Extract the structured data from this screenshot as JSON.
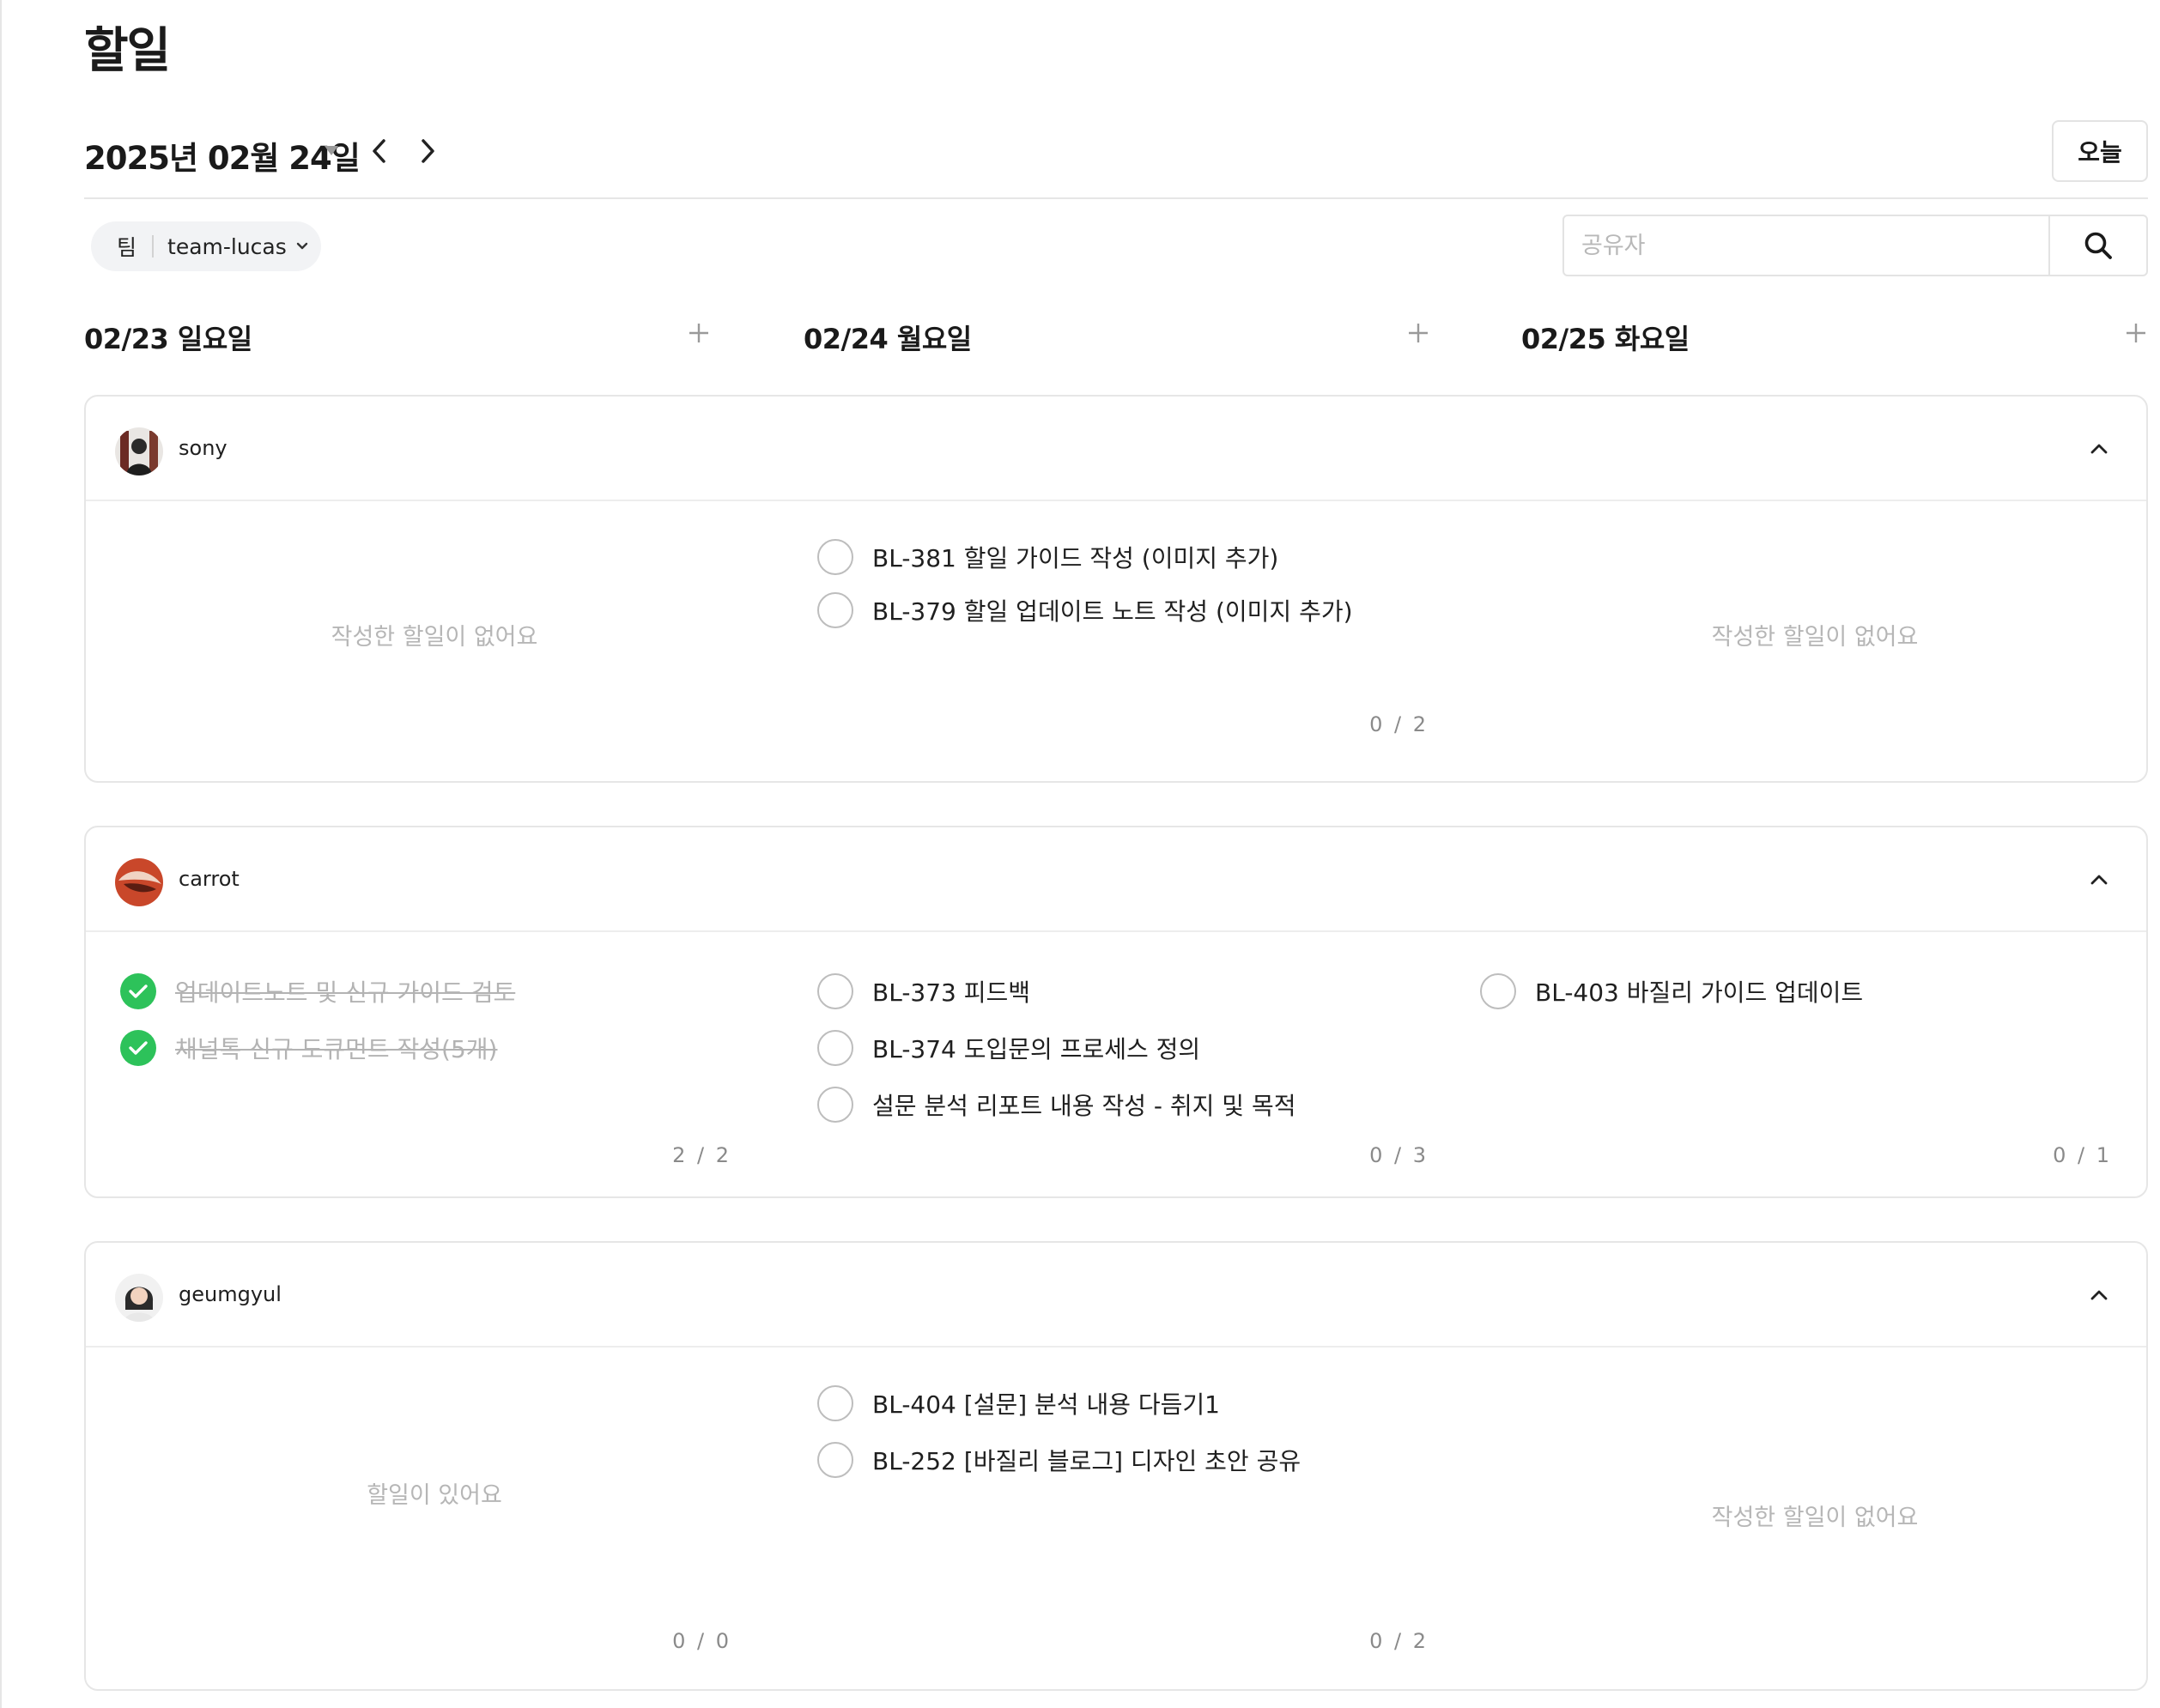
{
  "page": {
    "title": "할일"
  },
  "date_nav": {
    "current_date": "2025년 02월 24일",
    "prev_icon": "chevron-left-icon",
    "next_icon": "chevron-right-icon",
    "today_label": "오늘"
  },
  "team_filter": {
    "label": "팀",
    "value": "team-lucas"
  },
  "search": {
    "placeholder": "공유자",
    "value": ""
  },
  "days": [
    {
      "label": "02/23 일요일"
    },
    {
      "label": "02/24 월요일"
    },
    {
      "label": "02/25 화요일"
    }
  ],
  "members": [
    {
      "name": "sony",
      "columns": [
        {
          "empty_text": "작성한 할일이 없어요",
          "todos": [],
          "counter": ""
        },
        {
          "empty_text": "",
          "todos": [
            {
              "text": "BL-381 할일 가이드 작성 (이미지 추가)",
              "done": false
            },
            {
              "text": "BL-379 할일 업데이트 노트 작성 (이미지 추가)",
              "done": false
            }
          ],
          "counter": "0 / 2"
        },
        {
          "empty_text": "작성한 할일이 없어요",
          "todos": [],
          "counter": ""
        }
      ]
    },
    {
      "name": "carrot",
      "columns": [
        {
          "empty_text": "",
          "todos": [
            {
              "text": "업데이트노트 및 신규 가이드 검토",
              "done": true
            },
            {
              "text": "채널톡 신규 도큐먼트 작성(5개)",
              "done": true
            }
          ],
          "counter": "2 / 2"
        },
        {
          "empty_text": "",
          "todos": [
            {
              "text": "BL-373 피드백",
              "done": false
            },
            {
              "text": "BL-374 도입문의 프로세스 정의",
              "done": false
            },
            {
              "text": "설문 분석 리포트 내용 작성 - 취지 및 목적",
              "done": false
            }
          ],
          "counter": "0 / 3"
        },
        {
          "empty_text": "",
          "todos": [
            {
              "text": "BL-403 바질리 가이드 업데이트",
              "done": false
            }
          ],
          "counter": "0 / 1"
        }
      ]
    },
    {
      "name": "geumgyul",
      "columns": [
        {
          "empty_text": "할일이 있어요",
          "todos": [],
          "counter": "0 / 0"
        },
        {
          "empty_text": "",
          "todos": [
            {
              "text": "BL-404 [설문] 분석 내용 다듬기1",
              "done": false
            },
            {
              "text": "BL-252 [바질리 블로그] 디자인 초안 공유",
              "done": false
            }
          ],
          "counter": "0 / 2"
        },
        {
          "empty_text": "작성한 할일이 없어요",
          "todos": [],
          "counter": ""
        }
      ]
    }
  ],
  "icons": {
    "search": "search-icon",
    "add": "plus-icon",
    "collapse": "chevron-up-icon",
    "dropdown": "chevron-down-icon",
    "check": "check-icon"
  },
  "colors": {
    "done_check": "#2dc25a",
    "muted_text": "#b6b6b6",
    "border": "#e6e6e6"
  }
}
